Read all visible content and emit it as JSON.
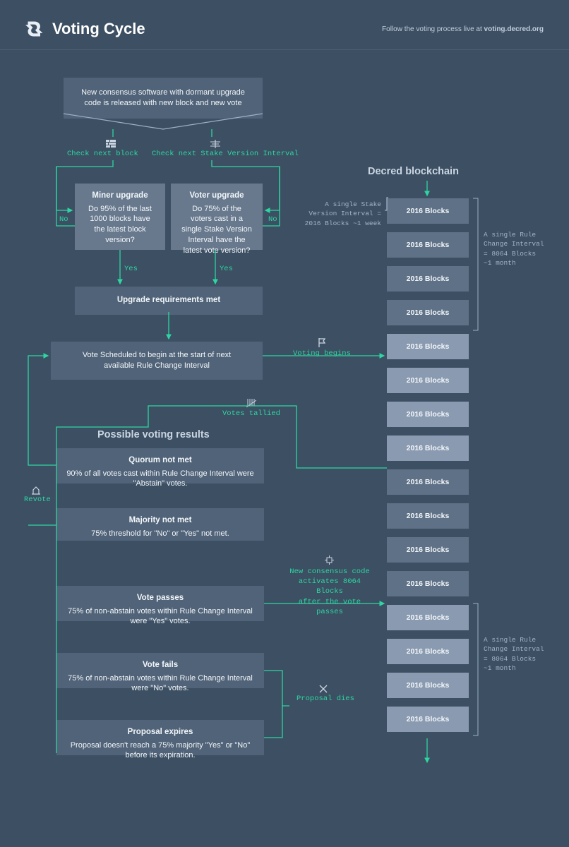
{
  "header": {
    "title": "Voting Cycle",
    "subtitle_prefix": "Follow the voting process live at ",
    "subtitle_link": "voting.decred.org"
  },
  "labels": {
    "check_next_block": "Check next block",
    "check_next_svi": "Check next Stake Version Interval",
    "no": "No",
    "yes": "Yes",
    "voting_begins": "Voting begins",
    "votes_tallied": "Votes tallied",
    "revote": "Revote",
    "new_consensus_code": "New consensus code",
    "activates_8064": "activates 8064 Blocks",
    "after_vote_passes": "after the vote passes",
    "proposal_dies": "Proposal dies"
  },
  "sections": {
    "blockchain": "Decred blockchain",
    "results": "Possible voting results"
  },
  "boxes": {
    "new_consensus": "New consensus software with dormant upgrade code is released with new block and new vote",
    "miner_upgrade_title": "Miner upgrade",
    "miner_upgrade_body": "Do 95% of the last 1000 blocks have the latest block version?",
    "voter_upgrade_title": "Voter upgrade",
    "voter_upgrade_body": "Do 75% of the voters cast in a single Stake Version Interval have the latest vote version?",
    "upgrade_met": "Upgrade requirements met",
    "vote_scheduled": "Vote Scheduled to begin at the start of next available Rule Change Interval",
    "quorum_title": "Quorum not met",
    "quorum_body": "90% of all votes cast within Rule Change Interval were \"Abstain\" votes.",
    "majority_title": "Majority not met",
    "majority_body": "75% threshold for \"No\" or \"Yes\" not met.",
    "passes_title": "Vote passes",
    "passes_body": "75% of non-abstain votes within Rule Change Interval were \"Yes\" votes.",
    "fails_title": "Vote fails",
    "fails_body": "75% of non-abstain votes within Rule Change Interval were \"No\" votes.",
    "expires_title": "Proposal expires",
    "expires_body": "Proposal doesn't reach a 75% majority \"Yes\" or \"No\" before its expiration."
  },
  "blockchain": {
    "block_label": "2016 Blocks",
    "svi_note_1": "A single Stake",
    "svi_note_2": "Version Interval =",
    "svi_note_3": "2016 Blocks ~1 week",
    "rci_note_1": "A single Rule",
    "rci_note_2": "Change Interval",
    "rci_note_3": "= 8064 Blocks",
    "rci_note_4": "~1 month"
  }
}
